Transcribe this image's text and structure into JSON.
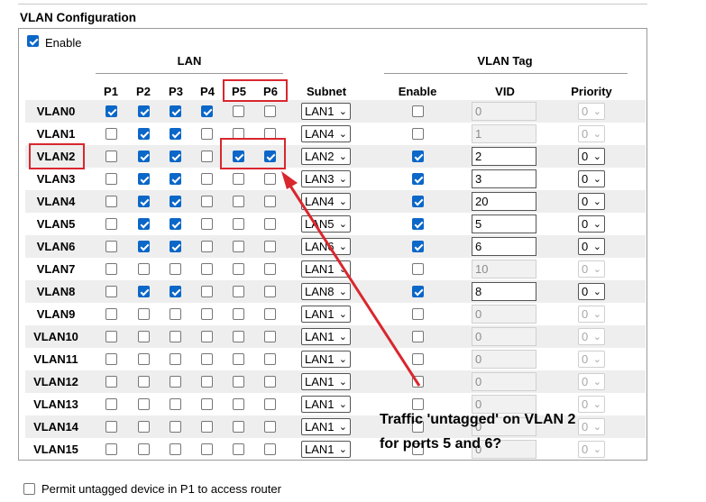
{
  "title": "VLAN Configuration",
  "enable_label": "Enable",
  "enable_checked": true,
  "groups": {
    "lan": "LAN",
    "vlan_tag": "VLAN Tag"
  },
  "columns": {
    "p1": "P1",
    "p2": "P2",
    "p3": "P3",
    "p4": "P4",
    "p5": "P5",
    "p6": "P6",
    "subnet": "Subnet",
    "enable": "Enable",
    "vid": "VID",
    "priority": "Priority"
  },
  "rows": [
    {
      "name": "VLAN0",
      "ports": [
        true,
        true,
        true,
        true,
        false,
        false
      ],
      "subnet": "LAN1",
      "tag_enable": false,
      "vid": "0",
      "priority": "0",
      "tag_disabled": true
    },
    {
      "name": "VLAN1",
      "ports": [
        false,
        true,
        true,
        false,
        false,
        false
      ],
      "subnet": "LAN4",
      "tag_enable": false,
      "vid": "1",
      "priority": "0",
      "tag_disabled": true
    },
    {
      "name": "VLAN2",
      "ports": [
        false,
        true,
        true,
        false,
        true,
        true
      ],
      "subnet": "LAN2",
      "tag_enable": true,
      "vid": "2",
      "priority": "0",
      "tag_disabled": false
    },
    {
      "name": "VLAN3",
      "ports": [
        false,
        true,
        true,
        false,
        false,
        false
      ],
      "subnet": "LAN3",
      "tag_enable": true,
      "vid": "3",
      "priority": "0",
      "tag_disabled": false
    },
    {
      "name": "VLAN4",
      "ports": [
        false,
        true,
        true,
        false,
        false,
        false
      ],
      "subnet": "LAN4",
      "tag_enable": true,
      "vid": "20",
      "priority": "0",
      "tag_disabled": false
    },
    {
      "name": "VLAN5",
      "ports": [
        false,
        true,
        true,
        false,
        false,
        false
      ],
      "subnet": "LAN5",
      "tag_enable": true,
      "vid": "5",
      "priority": "0",
      "tag_disabled": false
    },
    {
      "name": "VLAN6",
      "ports": [
        false,
        true,
        true,
        false,
        false,
        false
      ],
      "subnet": "LAN6",
      "tag_enable": true,
      "vid": "6",
      "priority": "0",
      "tag_disabled": false
    },
    {
      "name": "VLAN7",
      "ports": [
        false,
        false,
        false,
        false,
        false,
        false
      ],
      "subnet": "LAN1",
      "tag_enable": false,
      "vid": "10",
      "priority": "0",
      "tag_disabled": true
    },
    {
      "name": "VLAN8",
      "ports": [
        false,
        true,
        true,
        false,
        false,
        false
      ],
      "subnet": "LAN8",
      "tag_enable": true,
      "vid": "8",
      "priority": "0",
      "tag_disabled": false
    },
    {
      "name": "VLAN9",
      "ports": [
        false,
        false,
        false,
        false,
        false,
        false
      ],
      "subnet": "LAN1",
      "tag_enable": false,
      "vid": "0",
      "priority": "0",
      "tag_disabled": true
    },
    {
      "name": "VLAN10",
      "ports": [
        false,
        false,
        false,
        false,
        false,
        false
      ],
      "subnet": "LAN1",
      "tag_enable": false,
      "vid": "0",
      "priority": "0",
      "tag_disabled": true
    },
    {
      "name": "VLAN11",
      "ports": [
        false,
        false,
        false,
        false,
        false,
        false
      ],
      "subnet": "LAN1",
      "tag_enable": false,
      "vid": "0",
      "priority": "0",
      "tag_disabled": true
    },
    {
      "name": "VLAN12",
      "ports": [
        false,
        false,
        false,
        false,
        false,
        false
      ],
      "subnet": "LAN1",
      "tag_enable": false,
      "vid": "0",
      "priority": "0",
      "tag_disabled": true
    },
    {
      "name": "VLAN13",
      "ports": [
        false,
        false,
        false,
        false,
        false,
        false
      ],
      "subnet": "LAN1",
      "tag_enable": false,
      "vid": "0",
      "priority": "0",
      "tag_disabled": true
    },
    {
      "name": "VLAN14",
      "ports": [
        false,
        false,
        false,
        false,
        false,
        false
      ],
      "subnet": "LAN1",
      "tag_enable": false,
      "vid": "0",
      "priority": "0",
      "tag_disabled": true
    },
    {
      "name": "VLAN15",
      "ports": [
        false,
        false,
        false,
        false,
        false,
        false
      ],
      "subnet": "LAN1",
      "tag_enable": false,
      "vid": "0",
      "priority": "0",
      "tag_disabled": true
    }
  ],
  "annotation": {
    "line1": "Traffic 'untagged' on VLAN 2",
    "line2": "for ports 5 and 6?"
  },
  "permit_untagged": {
    "label": "Permit untagged device in P1 to access router",
    "checked": false
  },
  "colors": {
    "accent": "#0b67c8",
    "highlight": "#d9272e",
    "row_shade": "#eeeeee"
  }
}
